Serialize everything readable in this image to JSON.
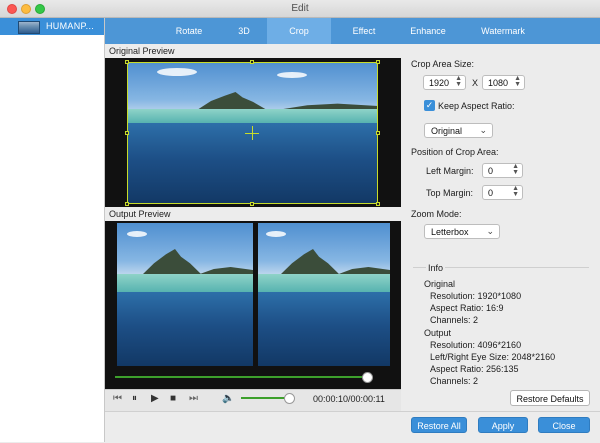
{
  "window": {
    "title": "Edit"
  },
  "sidebar": {
    "items": [
      {
        "label": "HUMANP..."
      }
    ]
  },
  "tabs": [
    {
      "label": "Rotate"
    },
    {
      "label": "3D"
    },
    {
      "label": "Crop"
    },
    {
      "label": "Effect"
    },
    {
      "label": "Enhance"
    },
    {
      "label": "Watermark"
    }
  ],
  "active_tab": "Crop",
  "preview": {
    "original_label": "Original Preview",
    "output_label": "Output Preview"
  },
  "playback": {
    "timecode": "00:00:10/00:00:11",
    "progress_fraction": 0.95,
    "volume_fraction": 0.9
  },
  "crop": {
    "area_size_label": "Crop Area Size:",
    "width": "1920",
    "separator": "X",
    "height": "1080",
    "keep_aspect_label": "Keep Aspect Ratio:",
    "keep_aspect_checked": true,
    "aspect_option": "Original",
    "position_label": "Position of Crop Area:",
    "left_margin_label": "Left Margin:",
    "left_margin": "0",
    "top_margin_label": "Top Margin:",
    "top_margin": "0",
    "zoom_mode_label": "Zoom Mode:",
    "zoom_mode": "Letterbox"
  },
  "info": {
    "heading": "Info",
    "original_heading": "Original",
    "original_resolution": "Resolution: 1920*1080",
    "original_aspect": "Aspect Ratio: 16:9",
    "original_channels": "Channels: 2",
    "output_heading": "Output",
    "output_resolution": "Resolution: 4096*2160",
    "output_eye_size": "Left/Right Eye Size: 2048*2160",
    "output_aspect": "Aspect Ratio: 256:135",
    "output_channels": "Channels: 2"
  },
  "buttons": {
    "restore_defaults": "Restore Defaults",
    "restore_all": "Restore All",
    "apply": "Apply",
    "close": "Close"
  },
  "colors": {
    "accent": "#3a8fd9",
    "tab_bar": "#4d96d6",
    "tab_active": "#6eaee6",
    "progress": "#3da02c",
    "crop_frame": "#c7dc2b"
  },
  "icons": [
    "close-light",
    "minimize-light",
    "zoom-light",
    "skip-back-icon",
    "pause-icon",
    "play-icon",
    "stop-icon",
    "skip-forward-icon",
    "volume-icon",
    "checkmark-icon",
    "chevron-down-icon"
  ]
}
